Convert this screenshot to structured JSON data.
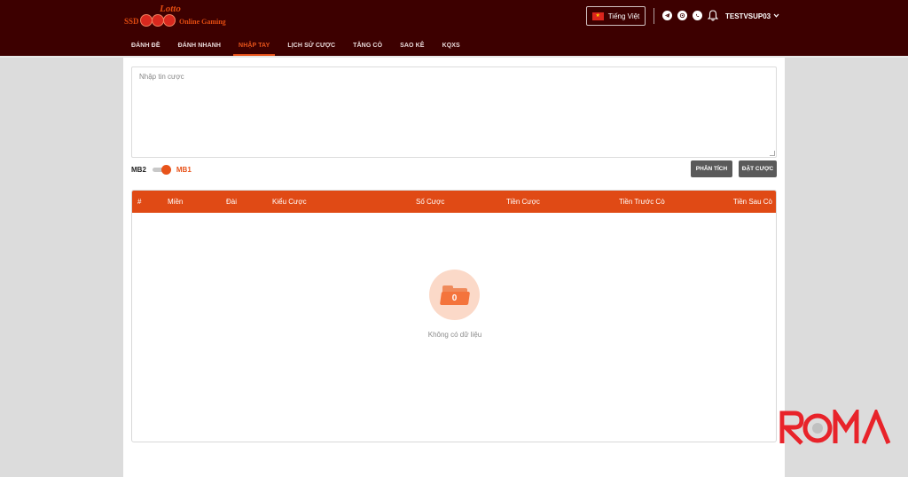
{
  "logo": {
    "top": "Lotto",
    "left": "SSD",
    "right": "Online Gaming"
  },
  "nav": {
    "items": [
      {
        "label": "ĐÁNH ĐỀ",
        "active": false
      },
      {
        "label": "ĐÁNH NHANH",
        "active": false
      },
      {
        "label": "NHẬP TAY",
        "active": true
      },
      {
        "label": "LỊCH SỬ CƯỢC",
        "active": false
      },
      {
        "label": "TĂNG CÒ",
        "active": false
      },
      {
        "label": "SAO KÊ",
        "active": false
      },
      {
        "label": "KQXS",
        "active": false
      }
    ]
  },
  "header": {
    "language": "Tiếng Việt",
    "username": "TESTVSUP03"
  },
  "bet_input": {
    "placeholder": "Nhập tin cược",
    "value": ""
  },
  "toggle": {
    "left_label": "MB2",
    "right_label": "MB1",
    "on": true
  },
  "actions": {
    "analyze": "PHÂN TÍCH",
    "place_bet": "ĐẶT CƯỢC"
  },
  "table": {
    "columns": [
      "#",
      "Miền",
      "Đài",
      "Kiểu Cược",
      "Số Cược",
      "Tiền Cược",
      "Tiền Trước Cò",
      "Tiền Sau Cò"
    ],
    "rows": []
  },
  "empty": {
    "count": "0",
    "message": "Không có dữ liệu"
  },
  "watermark": "ROMA",
  "colors": {
    "header_bg": "#3d0000",
    "accent": "#e8531a",
    "table_header": "#e04a15",
    "button": "#5a5a5a"
  }
}
